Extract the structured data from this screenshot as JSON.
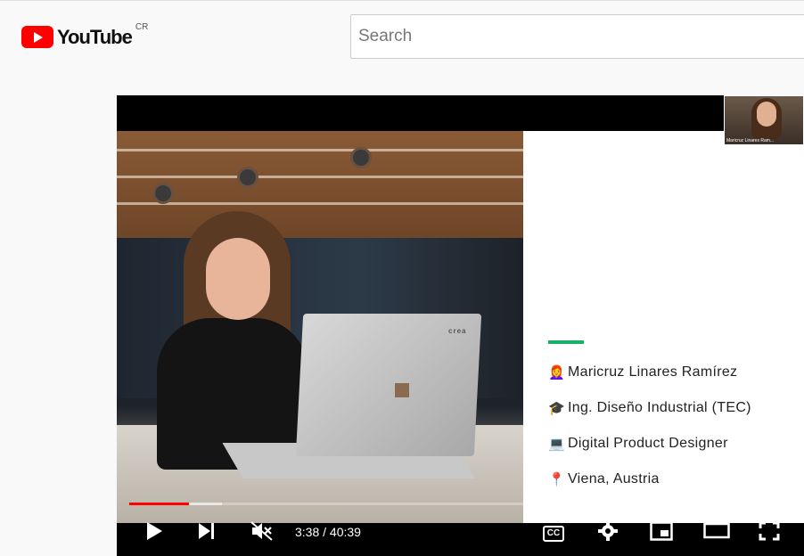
{
  "header": {
    "logo_text": "YouTube",
    "country_code": "CR",
    "search_placeholder": "Search"
  },
  "slide": {
    "items": [
      {
        "icon": "👩‍🦰",
        "text": "Maricruz Linares Ramírez"
      },
      {
        "icon": "🎓",
        "text": "Ing. Diseño Industrial (TEC)"
      },
      {
        "icon": "💻",
        "text": "Digital Product Designer"
      },
      {
        "icon": "📍",
        "text": "Viena, Austria"
      }
    ],
    "camera_label": "Maricruz Linares Ram..."
  },
  "laptop_brand": "crea",
  "player": {
    "current_time": "3:38",
    "duration": "40:39",
    "time_display": "3:38 / 40:39",
    "played_fraction": 0.09,
    "buffered_fraction": 0.14,
    "cc_label": "CC"
  },
  "colors": {
    "brand_red": "#ff0000",
    "accent_green": "#17b26a"
  }
}
